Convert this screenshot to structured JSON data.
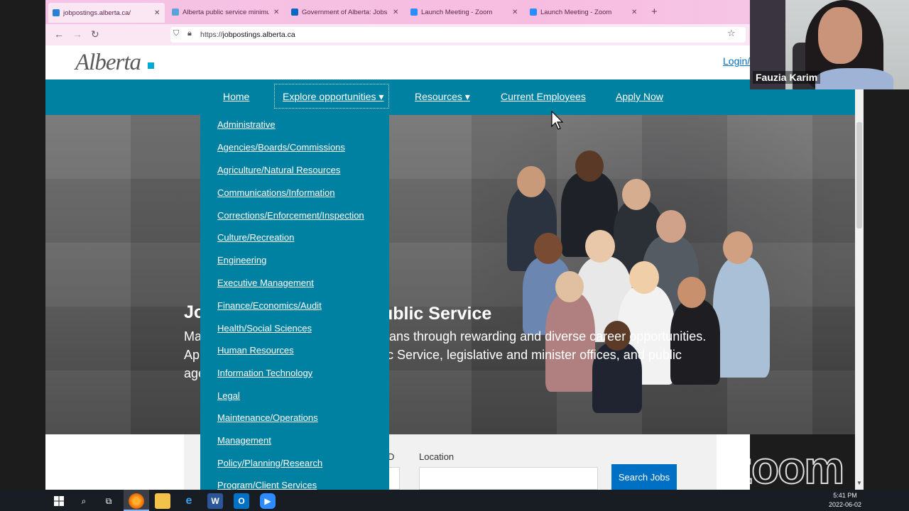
{
  "browser": {
    "tabs": [
      {
        "title": "jobpostings.alberta.ca/",
        "active": true,
        "favicon_color": "#2a7fd6"
      },
      {
        "title": "Alberta public service minimum",
        "active": false,
        "favicon_color": "#58a3d9"
      },
      {
        "title": "Government of Alberta: Jobs | L",
        "active": false,
        "favicon_color": "#0a66c2"
      },
      {
        "title": "Launch Meeting - Zoom",
        "active": false,
        "favicon_color": "#2d8cff"
      },
      {
        "title": "Launch Meeting - Zoom",
        "active": false,
        "favicon_color": "#2d8cff"
      }
    ],
    "url_prefix": "https://",
    "url_host": "jobpostings.alberta.ca",
    "icons": {
      "back": "back-arrow-icon",
      "forward": "forward-arrow-icon",
      "reload": "reload-icon",
      "shield": "shield-icon",
      "lock": "lock-icon",
      "bookmark": "star-icon",
      "new_tab": "plus-icon",
      "close": "close-icon"
    }
  },
  "site": {
    "logo_text": "Alberta",
    "login_label": "Login/",
    "brand_color": "#0081a1",
    "nav": {
      "home": "Home",
      "explore": "Explore opportunities ▾",
      "resources": "Resources ▾",
      "current_employees": "Current Employees",
      "apply_now": "Apply Now"
    },
    "dropdown_items": [
      "Administrative",
      "Agencies/Boards/Commissions",
      "Agriculture/Natural Resources",
      "Communications/Information",
      "Corrections/Enforcement/Inspection",
      "Culture/Recreation",
      "Engineering",
      "Executive Management",
      "Finance/Economics/Audit",
      "Health/Social Sciences",
      "Human Resources",
      "Information Technology",
      "Legal",
      "Maintenance/Operations",
      "Management",
      "Policy/Planning/Research",
      "Program/Client Services"
    ],
    "hero": {
      "title_left": "Jo",
      "title_right": "ublic Service",
      "line1_left": "Ma",
      "line1_right": "rtans through rewarding and diverse career opportunities.",
      "line2_left": "Ap",
      "line2_right": "lic Service, legislative and minister offices, and public",
      "line3_left": "age"
    },
    "search": {
      "id_label": "D",
      "location_label": "Location",
      "button_label": "Search Jobs"
    }
  },
  "zoom": {
    "participant_name": "Fauzia Karim",
    "watermark": "zoom"
  },
  "taskbar": {
    "time": "5:41 PM",
    "date": "2022-06-02",
    "icons": [
      "windows-start-icon",
      "search-icon",
      "task-view-icon",
      "firefox-icon",
      "file-explorer-icon",
      "edge-icon",
      "word-icon",
      "outlook-icon",
      "zoom-icon"
    ]
  }
}
